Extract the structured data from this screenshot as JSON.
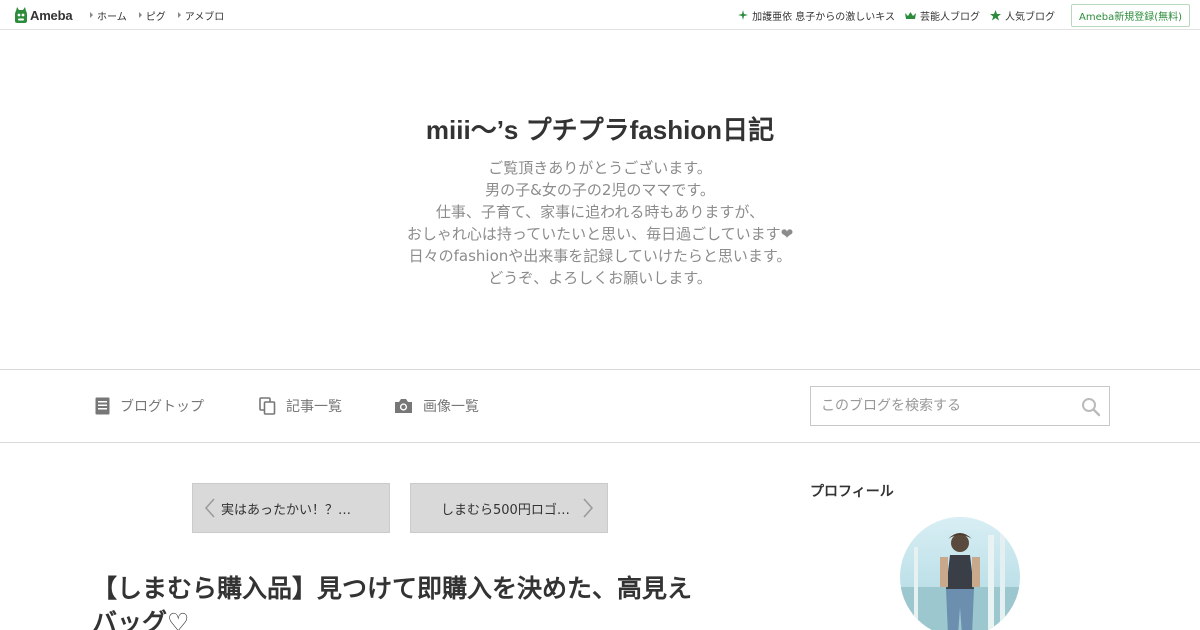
{
  "topbar": {
    "logo_text": "Ameba",
    "nav": [
      {
        "label": "ホーム"
      },
      {
        "label": "ピグ"
      },
      {
        "label": "アメブロ"
      }
    ],
    "right_links": [
      {
        "label": "加護亜依 息子からの激しいキス",
        "icon": "sparkle-icon"
      },
      {
        "label": "芸能人ブログ",
        "icon": "crown-icon"
      },
      {
        "label": "人気ブログ",
        "icon": "star-icon"
      }
    ],
    "register_label": "Ameba新規登録(無料)",
    "accent_color": "#2d8c3c"
  },
  "blog": {
    "title": "miii〜’s プチプラfashion日記",
    "description": [
      "ご覧頂きありがとうございます。",
      "男の子&女の子の2児のママです。",
      "仕事、子育て、家事に追われる時もありますが、",
      "おしゃれ心は持っていたいと思い、毎日過ごしています❤",
      "日々のfashionや出来事を記録していけたらと思います。",
      "どうぞ、よろしくお願いします。"
    ]
  },
  "navbar": {
    "items": [
      {
        "label": "ブログトップ",
        "icon": "document-icon"
      },
      {
        "label": "記事一覧",
        "icon": "copy-icon"
      },
      {
        "label": "画像一覧",
        "icon": "camera-icon"
      }
    ],
    "search_placeholder": "このブログを検索する"
  },
  "article": {
    "prev_title": "実はあったかい！？…",
    "next_title": "しまむら500円ロゴ…",
    "title": "【しまむら購入品】見つけて即購入を決めた、高見えバッグ♡"
  },
  "sidebar": {
    "profile_heading": "プロフィール"
  }
}
